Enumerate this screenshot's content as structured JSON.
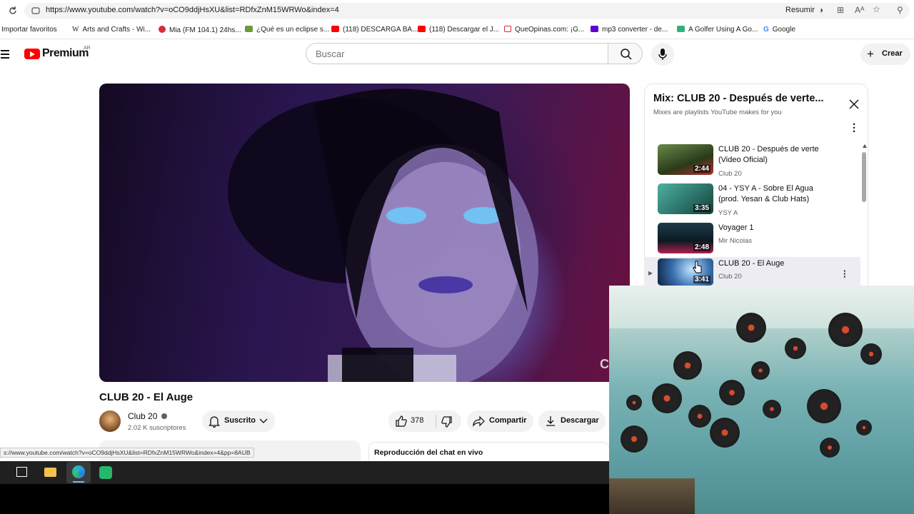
{
  "browser": {
    "url": "https://www.youtube.com/watch?v=oCO9ddjHsXU&list=RDfxZnM15WRWo&index=4",
    "resumir_label": "Resumir",
    "bookmarks": [
      "Importar favoritos",
      "Arts and Crafts - Wi...",
      "Mia (FM 104.1) 24hs...",
      "¿Qué es un eclipse s...",
      "(118) DESCARGA BA...",
      "(118) Descargar el J...",
      "QueOpinas.com: ¡G...",
      "mp3 converter - de...",
      "A Golfer Using A Go...",
      "Google"
    ],
    "status_url": "s://www.youtube.com/watch?v=oCO9ddjHsXU&list=RDfxZnM15WRWo&index=4&pp=8AUB"
  },
  "header": {
    "brand": "Premium",
    "country": "AR",
    "search_placeholder": "Buscar",
    "create_label": "Crear"
  },
  "player": {
    "overlay_mark": "CLU"
  },
  "video": {
    "title": "CLUB 20 - El Auge",
    "channel": "Club 20",
    "subscribers": "2.02 K suscriptores",
    "subscribe_label": "Suscrito",
    "likes": "378",
    "share_label": "Compartir",
    "download_label": "Descargar",
    "chat_label": "Reproducción del chat en vivo"
  },
  "playlist": {
    "title": "Mix: CLUB 20 - Después de verte...",
    "subtitle": "Mixes are playlists YouTube makes for you",
    "items": [
      {
        "title": "CLUB 20 - Después de verte (Video Oficial)",
        "channel": "Club 20",
        "duration": "2:44",
        "thumb_color": "#3a5a2a"
      },
      {
        "title": "04 - YSY A - Sobre El Agua (prod. Yesan & Club Hats)",
        "channel": "YSY A",
        "duration": "3:35",
        "thumb_color": "#2f7a70"
      },
      {
        "title": "Voyager 1",
        "channel": "Mir Nicolas",
        "duration": "2:48",
        "thumb_color": "#1e3a48"
      },
      {
        "title": "CLUB 20 - El Auge",
        "channel": "Club 20",
        "duration": "3:41",
        "thumb_color": "#3a6fae"
      }
    ]
  },
  "colors": {
    "accent": "#ff0000",
    "taskbar": "#202020"
  }
}
